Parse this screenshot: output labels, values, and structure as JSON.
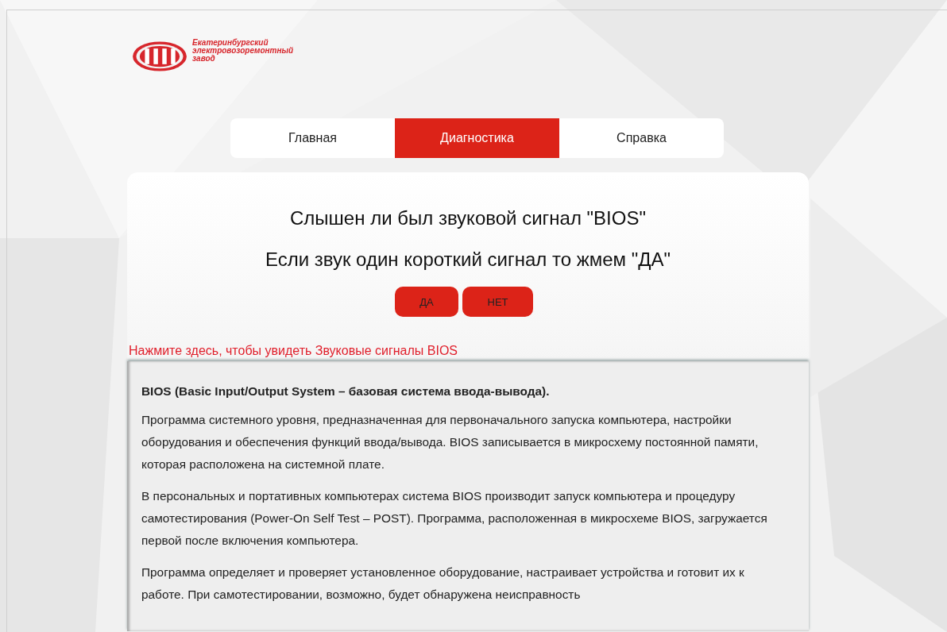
{
  "logo": {
    "lines": [
      "Екатеринбургский",
      "электровозоремонтный",
      "завод"
    ]
  },
  "tabs": [
    {
      "label": "Главная",
      "selected": false
    },
    {
      "label": "Диагностика",
      "selected": true
    },
    {
      "label": "Справка",
      "selected": false
    }
  ],
  "question": {
    "title": "Слышен ли был звуковой сигнал \"BIOS\"",
    "hint": "Если звук один короткий сигнал то жмем \"ДА\""
  },
  "buttons": [
    "ДА",
    "НЕТ"
  ],
  "link": "Нажмите здесь, чтобы увидеть Звуковые сигналы BIOS",
  "info": {
    "heading": "BIOS (Basic Input/Output System – базовая система ввода-вывода).",
    "paragraphs": [
      "Программа системного уровня, предназначенная для первоначального запуска компьютера, настройки оборудования и обеспечения функций ввода/вывода. BIOS записывается в микросхему постоянной памяти, которая расположена на системной плате.",
      "В персональных и портативных компьютерах система BIOS производит запуск компьютера и процедуру самотестирования (Power-On Self Test – POST). Программа, расположенная в микросхеме BIOS, загружается первой после включения компьютера.",
      "Программа определяет и проверяет установленное оборудование, настраивает устройства и готовит их к работе. При самотестировании, возможно, будет обнаружена неисправность"
    ]
  }
}
